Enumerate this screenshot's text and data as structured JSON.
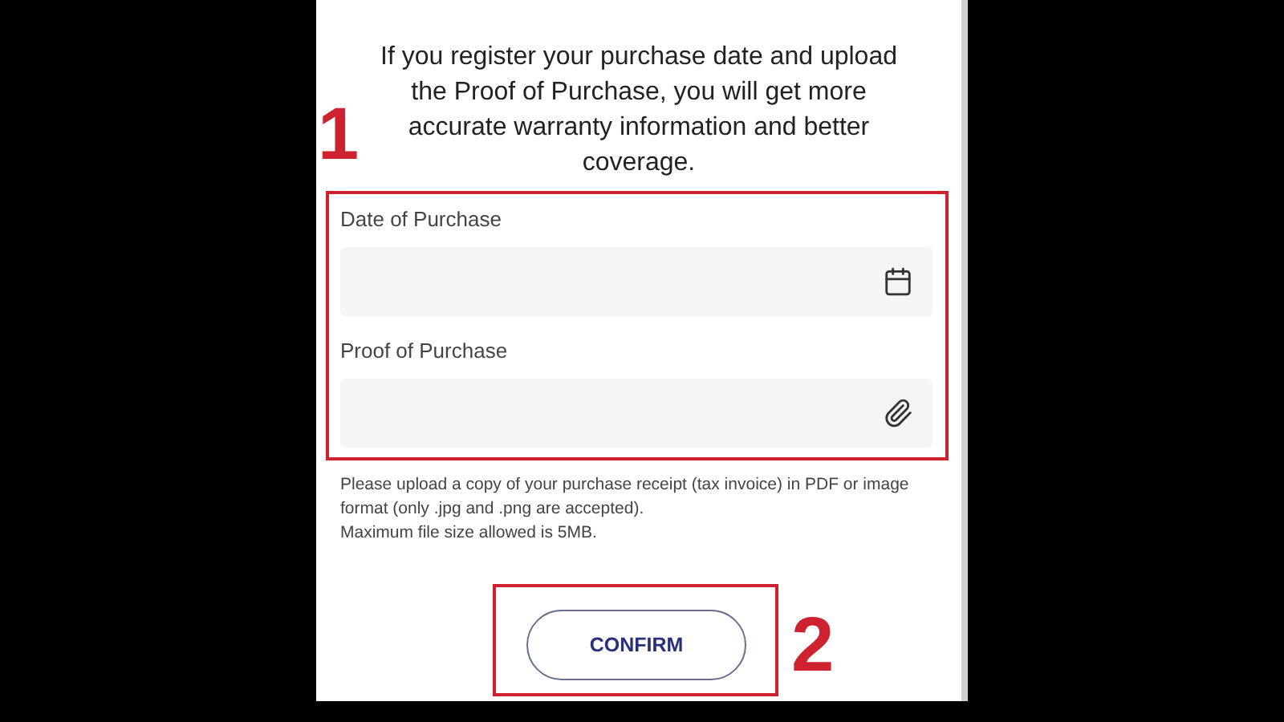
{
  "intro": "If you register your purchase date and upload the Proof of Purchase, you will get more accurate warranty information and better coverage.",
  "fields": [
    {
      "label": "Date of Purchase",
      "kind": "date"
    },
    {
      "label": "Proof of Purchase",
      "kind": "file"
    }
  ],
  "helper_text": [
    "Please upload a copy of your purchase receipt (tax invoice) in PDF or image format (only .jpg and .png are accepted).",
    "Maximum file size allowed is 5MB."
  ],
  "confirm_button": "CONFIRM",
  "annotations": [
    {
      "label": "1"
    },
    {
      "label": "2"
    }
  ]
}
